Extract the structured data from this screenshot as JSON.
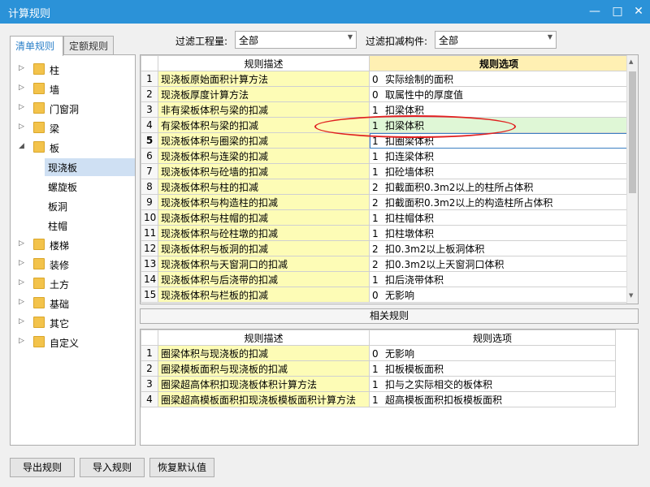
{
  "window": {
    "title": "计算规则",
    "min": "—",
    "max": "□",
    "close": "✕"
  },
  "filter": {
    "project_label": "过滤工程量:",
    "project_value": "全部",
    "component_label": "过滤扣减构件:",
    "component_value": "全部"
  },
  "tabs": [
    "清单规则",
    "定额规则"
  ],
  "tree": [
    {
      "label": "柱",
      "expanded": false
    },
    {
      "label": "墙",
      "expanded": false
    },
    {
      "label": "门窗洞",
      "expanded": false
    },
    {
      "label": "梁",
      "expanded": false
    },
    {
      "label": "板",
      "expanded": true,
      "children": [
        "现浇板",
        "螺旋板",
        "板洞",
        "柱帽"
      ],
      "selected_child": 0
    },
    {
      "label": "楼梯",
      "expanded": false
    },
    {
      "label": "装修",
      "expanded": false
    },
    {
      "label": "土方",
      "expanded": false
    },
    {
      "label": "基础",
      "expanded": false
    },
    {
      "label": "其它",
      "expanded": false
    },
    {
      "label": "自定义",
      "expanded": false
    }
  ],
  "main_grid": {
    "header_desc": "规则描述",
    "header_opt": "规则选项",
    "rows": [
      {
        "n": "1",
        "desc": "现浇板原始面积计算方法",
        "code": "0",
        "opt": "实际绘制的面积"
      },
      {
        "n": "2",
        "desc": "现浇板厚度计算方法",
        "code": "0",
        "opt": "取属性中的厚度值"
      },
      {
        "n": "3",
        "desc": "非有梁板体积与梁的扣减",
        "code": "1",
        "opt": "扣梁体积"
      },
      {
        "n": "4",
        "desc": "有梁板体积与梁的扣减",
        "code": "1",
        "opt": "扣梁体积"
      },
      {
        "n": "5",
        "desc": "现浇板体积与圈梁的扣减",
        "code": "1",
        "opt": "扣圈梁体积"
      },
      {
        "n": "6",
        "desc": "现浇板体积与连梁的扣减",
        "code": "1",
        "opt": "扣连梁体积"
      },
      {
        "n": "7",
        "desc": "现浇板体积与砼墙的扣减",
        "code": "1",
        "opt": "扣砼墙体积"
      },
      {
        "n": "8",
        "desc": "现浇板体积与柱的扣减",
        "code": "2",
        "opt": "扣截面积0.3m2以上的柱所占体积"
      },
      {
        "n": "9",
        "desc": "现浇板体积与构造柱的扣减",
        "code": "2",
        "opt": "扣截面积0.3m2以上的构造柱所占体积"
      },
      {
        "n": "10",
        "desc": "现浇板体积与柱帽的扣减",
        "code": "1",
        "opt": "扣柱帽体积"
      },
      {
        "n": "11",
        "desc": "现浇板体积与砼柱墩的扣减",
        "code": "1",
        "opt": "扣柱墩体积"
      },
      {
        "n": "12",
        "desc": "现浇板体积与板洞的扣减",
        "code": "2",
        "opt": "扣0.3m2以上板洞体积"
      },
      {
        "n": "13",
        "desc": "现浇板体积与天窗洞口的扣减",
        "code": "2",
        "opt": "扣0.3m2以上天窗洞口体积"
      },
      {
        "n": "14",
        "desc": "现浇板体积与后浇带的扣减",
        "code": "1",
        "opt": "扣后浇带体积"
      },
      {
        "n": "15",
        "desc": "现浇板体积与栏板的扣减",
        "code": "0",
        "opt": "无影响"
      }
    ],
    "current_row": 5,
    "highlight_row": 4
  },
  "related_label": "相关规则",
  "related_grid": {
    "header_desc": "规则描述",
    "header_opt": "规则选项",
    "rows": [
      {
        "n": "1",
        "desc": "圈梁体积与现浇板的扣减",
        "code": "0",
        "opt": "无影响"
      },
      {
        "n": "2",
        "desc": "圈梁模板面积与现浇板的扣减",
        "code": "1",
        "opt": "扣板模板面积"
      },
      {
        "n": "3",
        "desc": "圈梁超高体积扣现浇板体积计算方法",
        "code": "1",
        "opt": "扣与之实际相交的板体积"
      },
      {
        "n": "4",
        "desc": "圈梁超高模板面积扣现浇板模板面积计算方法",
        "code": "1",
        "opt": "超高模板面积扣板模板面积"
      }
    ]
  },
  "buttons": {
    "export": "导出规则",
    "import": "导入规则",
    "restore": "恢复默认值"
  },
  "colors": {
    "titlebar": "#2b92d8",
    "desc_bg": "#fdfcb6",
    "annotation": "#e02020"
  }
}
